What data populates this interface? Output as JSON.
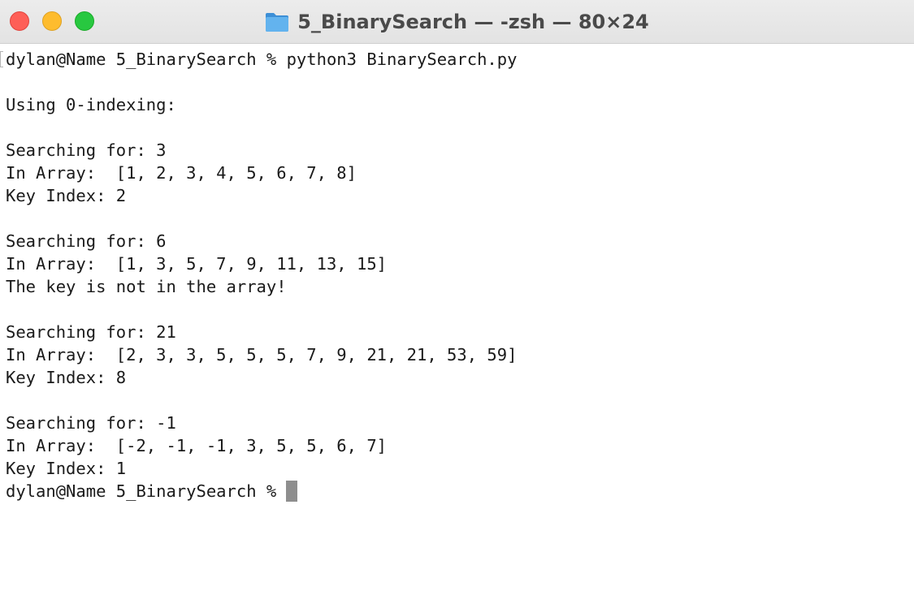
{
  "window": {
    "title": "5_BinarySearch — -zsh — 80×24",
    "folder_icon": "folder-icon",
    "colors": {
      "close": "#fe5f57",
      "minimize": "#febc2e",
      "zoom": "#28c840",
      "folder": "#56a9e8"
    }
  },
  "terminal": {
    "command_line": "dylan@Name 5_BinarySearch % python3 BinarySearch.py",
    "lines": [
      "",
      "Using 0-indexing:",
      "",
      "Searching for: 3",
      "In Array:  [1, 2, 3, 4, 5, 6, 7, 8]",
      "Key Index: 2",
      "",
      "Searching for: 6",
      "In Array:  [1, 3, 5, 7, 9, 11, 13, 15]",
      "The key is not in the array!",
      "",
      "Searching for: 21",
      "In Array:  [2, 3, 3, 5, 5, 5, 7, 9, 21, 21, 53, 59]",
      "Key Index: 8",
      "",
      "Searching for: -1",
      "In Array:  [-2, -1, -1, 3, 5, 5, 6, 7]",
      "Key Index: 1"
    ],
    "prompt": "dylan@Name 5_BinarySearch %"
  }
}
